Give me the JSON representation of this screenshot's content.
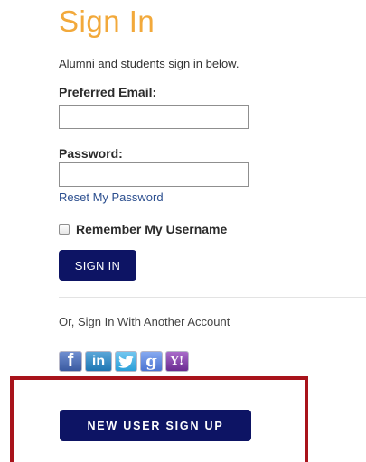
{
  "form": {
    "title": "Sign In",
    "subtitle": "Alumni and students sign in below.",
    "email_label": "Preferred Email:",
    "email_value": "",
    "password_label": "Password:",
    "password_value": "",
    "reset_link": "Reset My Password",
    "remember_label": "Remember My Username",
    "remember_checked": false,
    "signin_button": "SIGN IN"
  },
  "alt_signin": {
    "text": "Or, Sign In With Another Account",
    "providers": [
      {
        "name": "facebook",
        "icon": "facebook-icon",
        "glyph": "f",
        "color": "#3a5aa0"
      },
      {
        "name": "linkedin",
        "icon": "linkedin-icon",
        "glyph": "in",
        "color": "#1f77b4"
      },
      {
        "name": "twitter",
        "icon": "twitter-icon",
        "glyph": "bird",
        "color": "#2a9fd8"
      },
      {
        "name": "google",
        "icon": "google-icon",
        "glyph": "g",
        "color": "#4b74d2"
      },
      {
        "name": "yahoo",
        "icon": "yahoo-icon",
        "glyph": "Y!",
        "color": "#6b2c91"
      }
    ]
  },
  "new_user_button": "NEW USER SIGN UP",
  "colors": {
    "accent": "#f2a93b",
    "button": "#0d1464",
    "link": "#2c4f8f",
    "highlight": "#a8131b"
  }
}
